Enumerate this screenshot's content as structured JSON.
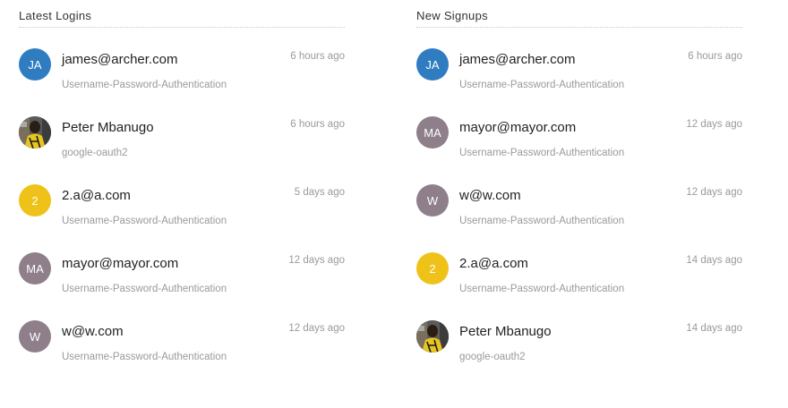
{
  "latest_logins": {
    "title": "Latest Logins",
    "items": [
      {
        "initials": "JA",
        "name": "james@archer.com",
        "connection": "Username-Password-Authentication",
        "time": "6 hours ago",
        "avatar_color": "#2f7cc0",
        "photo": false
      },
      {
        "initials": "",
        "name": "Peter Mbanugo",
        "connection": "google-oauth2",
        "time": "6 hours ago",
        "avatar_color": "#6b6b6b",
        "photo": true
      },
      {
        "initials": "2",
        "name": "2.a@a.com",
        "connection": "Username-Password-Authentication",
        "time": "5 days ago",
        "avatar_color": "#efc21a",
        "photo": false
      },
      {
        "initials": "MA",
        "name": "mayor@mayor.com",
        "connection": "Username-Password-Authentication",
        "time": "12 days ago",
        "avatar_color": "#8e7f8a",
        "photo": false
      },
      {
        "initials": "W",
        "name": "w@w.com",
        "connection": "Username-Password-Authentication",
        "time": "12 days ago",
        "avatar_color": "#8e7f8a",
        "photo": false
      }
    ]
  },
  "new_signups": {
    "title": "New Signups",
    "items": [
      {
        "initials": "JA",
        "name": "james@archer.com",
        "connection": "Username-Password-Authentication",
        "time": "6 hours ago",
        "avatar_color": "#2f7cc0",
        "photo": false
      },
      {
        "initials": "MA",
        "name": "mayor@mayor.com",
        "connection": "Username-Password-Authentication",
        "time": "12 days ago",
        "avatar_color": "#8e7f8a",
        "photo": false
      },
      {
        "initials": "W",
        "name": "w@w.com",
        "connection": "Username-Password-Authentication",
        "time": "12 days ago",
        "avatar_color": "#8e7f8a",
        "photo": false
      },
      {
        "initials": "2",
        "name": "2.a@a.com",
        "connection": "Username-Password-Authentication",
        "time": "14 days ago",
        "avatar_color": "#efc21a",
        "photo": false
      },
      {
        "initials": "",
        "name": "Peter Mbanugo",
        "connection": "google-oauth2",
        "time": "14 days ago",
        "avatar_color": "#6b6b6b",
        "photo": true
      }
    ]
  }
}
